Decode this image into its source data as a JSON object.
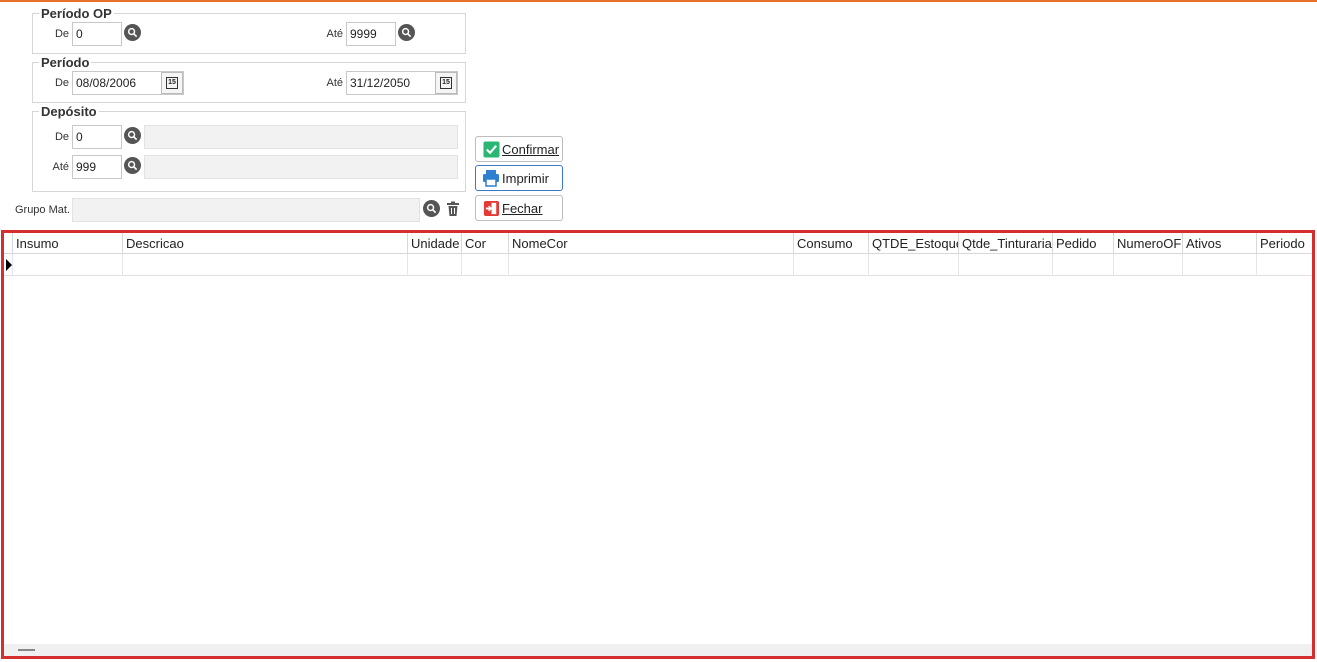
{
  "periodo_op": {
    "legend": "Período OP",
    "de_label": "De",
    "de_value": "0",
    "ate_label": "Até",
    "ate_value": "9999"
  },
  "periodo": {
    "legend": "Período",
    "de_label": "De",
    "de_value": "08/08/2006",
    "ate_label": "Até",
    "ate_value": "31/12/2050",
    "calendar_glyph": "15"
  },
  "deposito": {
    "legend": "Depósito",
    "de_label": "De",
    "de_value": "0",
    "de_desc": "",
    "ate_label": "Até",
    "ate_value": "999",
    "ate_desc": ""
  },
  "grupo_mat": {
    "label": "Grupo Mat.",
    "value": ""
  },
  "buttons": {
    "confirmar": "Confirmar",
    "imprimir": "Imprimir",
    "fechar": "Fechar"
  },
  "grid": {
    "columns": [
      "Insumo",
      "Descricao",
      "Unidade",
      "Cor",
      "NomeCor",
      "Consumo",
      "QTDE_Estoque",
      "Qtde_Tinturaria",
      "Pedido",
      "NumeroOF",
      "Ativos",
      "Periodo"
    ]
  },
  "colors": {
    "accent": "#e8702a",
    "selection_border": "#d32f2f",
    "confirm_icon": "#2bb673",
    "print_icon": "#2f7fd0",
    "close_icon": "#e53935"
  }
}
